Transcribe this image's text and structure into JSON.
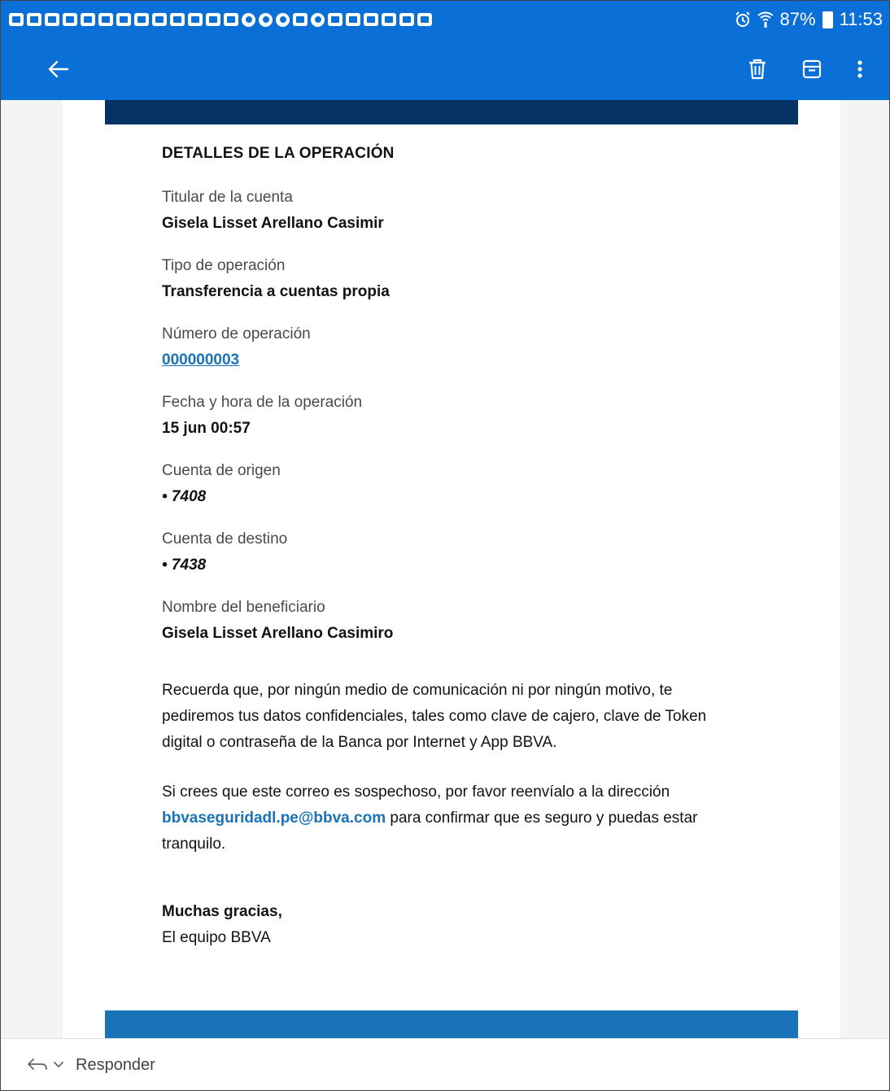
{
  "status_bar": {
    "battery": "87%",
    "time": "11:53",
    "notification_icons": [
      "f",
      "f",
      "f",
      "f",
      "f",
      "f",
      "f",
      "f",
      "f",
      "f",
      "f",
      "f",
      "f",
      "messenger",
      "messenger",
      "pinterest",
      "gallery",
      "reddit",
      "youtube",
      "youtube",
      "youtube",
      "youtube",
      "youtube",
      "youtube"
    ]
  },
  "toolbar": {
    "back_icon": "arrow-left-icon",
    "delete_icon": "trash-icon",
    "archive_icon": "archive-icon",
    "more_icon": "more-vertical-icon"
  },
  "email": {
    "section_title": "DETALLES DE LA OPERACIÓN",
    "fields": [
      {
        "label": "Titular de la cuenta",
        "value": "Gisela Lisset Arellano Casimir"
      },
      {
        "label": "Tipo de operación",
        "value": "Transferencia a cuentas propia"
      },
      {
        "label": "Número de operación",
        "value": "000000003"
      },
      {
        "label": "Fecha y hora de la operación",
        "value": "15 jun 00:57"
      },
      {
        "label": "Cuenta de origen",
        "value": "• 7408"
      },
      {
        "label": "Cuenta de destino",
        "value": "• 7438"
      },
      {
        "label": "Nombre del beneficiario",
        "value": "Gisela Lisset Arellano Casimiro"
      }
    ],
    "paragraph1": "Recuerda que, por ningún medio de comunicación ni por ningún motivo, te pediremos tus datos confidenciales, tales como clave de cajero, clave de Token digital o contraseña de la Banca por Internet y App BBVA.",
    "paragraph2_before": "Si crees que este correo es sospechoso, por favor reenvíalo a la dirección ",
    "paragraph2_email": "bbvaseguridadl.pe@bbva.com",
    "paragraph2_after": " para confirmar que es seguro y puedas estar tranquilo.",
    "thanks": "Muchas gracias,",
    "signature": "El equipo BBVA"
  },
  "bottom_bar": {
    "reply_label": "Responder"
  },
  "colors": {
    "app_bar": "#0a6fd6",
    "band_top": "#043263",
    "band_bottom": "#1973b8",
    "link": "#1973b8"
  }
}
